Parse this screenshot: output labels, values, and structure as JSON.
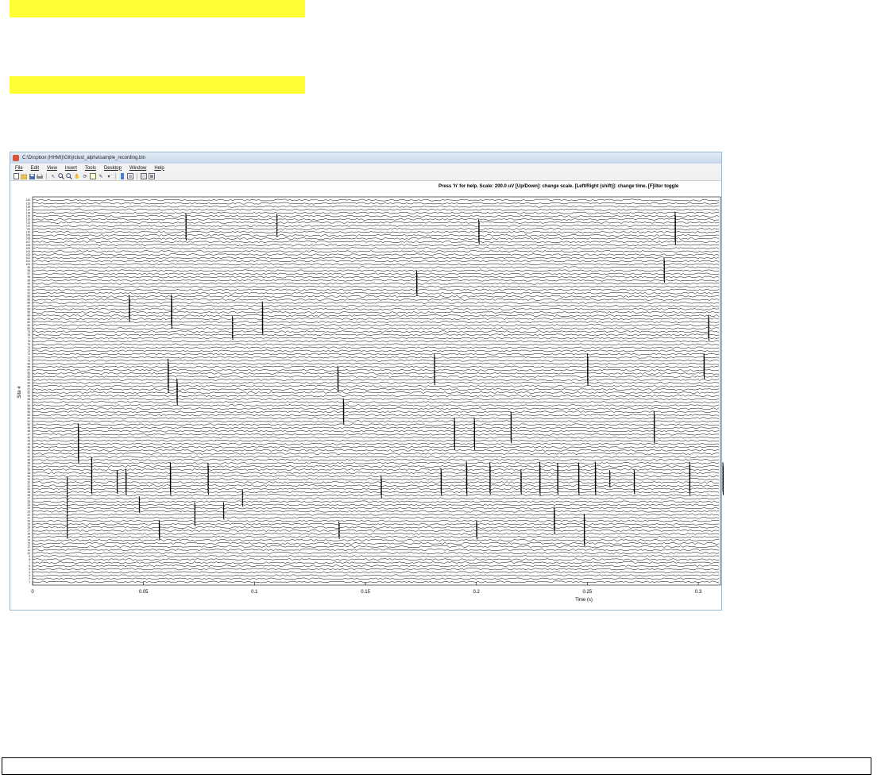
{
  "window": {
    "title": "C:\\Dropbox (HHMI)\\Git\\jrclust_alpha\\sample_recording.bin",
    "menu": [
      {
        "id": "file",
        "label": "File"
      },
      {
        "id": "edit",
        "label": "Edit"
      },
      {
        "id": "view",
        "label": "View"
      },
      {
        "id": "insert",
        "label": "Insert"
      },
      {
        "id": "tools",
        "label": "Tools"
      },
      {
        "id": "desktop",
        "label": "Desktop"
      },
      {
        "id": "window",
        "label": "Window"
      },
      {
        "id": "help",
        "label": "Help"
      }
    ],
    "toolbar_icons": [
      "new-file-icon",
      "open-file-icon",
      "save-icon",
      "print-icon",
      "pointer-icon",
      "zoom-in-icon",
      "zoom-out-icon",
      "pan-icon",
      "rotate-icon",
      "data-cursor-icon",
      "brush-icon",
      "link-icon",
      "colorbar-icon",
      "legend-icon",
      "grid-icon",
      "plot-tools-icon"
    ]
  },
  "plot": {
    "help_text": "Press 'h' for help. Scale: 200.0 uV [Up/Down]: change scale. [Left/Right (shift)]: change time. [F]ilter toggle",
    "chart_data": {
      "type": "line",
      "title": "",
      "xlabel": "Time (s)",
      "ylabel": "Site #",
      "xlim": [
        0,
        0.31
      ],
      "x_ticks": [
        0,
        0.05,
        0.1,
        0.15,
        0.2,
        0.25,
        0.3
      ],
      "x_tick_labels": [
        "0",
        "0.05",
        "0.1",
        "0.15",
        "0.2",
        "0.25",
        "0.3"
      ],
      "num_channels": 120,
      "scale_uV": 200.0,
      "trace_color": "#000000",
      "spike_events": [
        {
          "t": 0.0155,
          "ch_from": 14,
          "ch_to": 32,
          "amp": 1.0
        },
        {
          "t": 0.0205,
          "ch_from": 38,
          "ch_to": 48,
          "amp": 2.0
        },
        {
          "t": 0.0265,
          "ch_from": 28,
          "ch_to": 38,
          "amp": 1.4
        },
        {
          "t": 0.038,
          "ch_from": 28,
          "ch_to": 34,
          "amp": 1.2
        },
        {
          "t": 0.042,
          "ch_from": 28,
          "ch_to": 34,
          "amp": 1.8
        },
        {
          "t": 0.0435,
          "ch_from": 82,
          "ch_to": 88,
          "amp": 2.0
        },
        {
          "t": 0.048,
          "ch_from": 22,
          "ch_to": 26,
          "amp": 1.0
        },
        {
          "t": 0.057,
          "ch_from": 14,
          "ch_to": 18,
          "amp": 1.8
        },
        {
          "t": 0.061,
          "ch_from": 60,
          "ch_to": 68,
          "amp": 2.2
        },
        {
          "t": 0.062,
          "ch_from": 28,
          "ch_to": 36,
          "amp": 2.0
        },
        {
          "t": 0.0625,
          "ch_from": 80,
          "ch_to": 88,
          "amp": 2.2
        },
        {
          "t": 0.065,
          "ch_from": 56,
          "ch_to": 62,
          "amp": 2.0
        },
        {
          "t": 0.069,
          "ch_from": 107,
          "ch_to": 114,
          "amp": 1.2
        },
        {
          "t": 0.073,
          "ch_from": 18,
          "ch_to": 24,
          "amp": 1.2
        },
        {
          "t": 0.079,
          "ch_from": 28,
          "ch_to": 36,
          "amp": 1.6
        },
        {
          "t": 0.086,
          "ch_from": 20,
          "ch_to": 24,
          "amp": 1.2
        },
        {
          "t": 0.09,
          "ch_from": 76,
          "ch_to": 82,
          "amp": 1.2
        },
        {
          "t": 0.0945,
          "ch_from": 24,
          "ch_to": 28,
          "amp": 1.0
        },
        {
          "t": 0.1035,
          "ch_from": 78,
          "ch_to": 86,
          "amp": 2.0
        },
        {
          "t": 0.11,
          "ch_from": 108,
          "ch_to": 114,
          "amp": 1.0
        },
        {
          "t": 0.1375,
          "ch_from": 60,
          "ch_to": 66,
          "amp": 1.8
        },
        {
          "t": 0.138,
          "ch_from": 14,
          "ch_to": 18,
          "amp": 1.2
        },
        {
          "t": 0.14,
          "ch_from": 50,
          "ch_to": 56,
          "amp": 1.8
        },
        {
          "t": 0.157,
          "ch_from": 27,
          "ch_to": 32,
          "amp": 1.6
        },
        {
          "t": 0.173,
          "ch_from": 90,
          "ch_to": 96,
          "amp": 1.6
        },
        {
          "t": 0.181,
          "ch_from": 62,
          "ch_to": 70,
          "amp": 1.4
        },
        {
          "t": 0.184,
          "ch_from": 28,
          "ch_to": 34,
          "amp": 2.0
        },
        {
          "t": 0.19,
          "ch_from": 42,
          "ch_to": 50,
          "amp": 1.8
        },
        {
          "t": 0.1955,
          "ch_from": 28,
          "ch_to": 36,
          "amp": 2.2
        },
        {
          "t": 0.199,
          "ch_from": 42,
          "ch_to": 50,
          "amp": 1.8
        },
        {
          "t": 0.2,
          "ch_from": 14,
          "ch_to": 18,
          "amp": 1.6
        },
        {
          "t": 0.201,
          "ch_from": 106,
          "ch_to": 112,
          "amp": 1.4
        },
        {
          "t": 0.206,
          "ch_from": 28,
          "ch_to": 36,
          "amp": 1.6
        },
        {
          "t": 0.2155,
          "ch_from": 44,
          "ch_to": 52,
          "amp": 1.6
        },
        {
          "t": 0.22,
          "ch_from": 28,
          "ch_to": 34,
          "amp": 1.4
        },
        {
          "t": 0.2285,
          "ch_from": 28,
          "ch_to": 36,
          "amp": 2.0
        },
        {
          "t": 0.235,
          "ch_from": 16,
          "ch_to": 22,
          "amp": 2.0
        },
        {
          "t": 0.2365,
          "ch_from": 28,
          "ch_to": 36,
          "amp": 1.6
        },
        {
          "t": 0.246,
          "ch_from": 28,
          "ch_to": 36,
          "amp": 1.8
        },
        {
          "t": 0.2485,
          "ch_from": 12,
          "ch_to": 20,
          "amp": 1.8
        },
        {
          "t": 0.25,
          "ch_from": 62,
          "ch_to": 70,
          "amp": 1.8
        },
        {
          "t": 0.2535,
          "ch_from": 28,
          "ch_to": 36,
          "amp": 2.0
        },
        {
          "t": 0.26,
          "ch_from": 30,
          "ch_to": 34,
          "amp": 1.2
        },
        {
          "t": 0.271,
          "ch_from": 28,
          "ch_to": 34,
          "amp": 1.4
        },
        {
          "t": 0.28,
          "ch_from": 44,
          "ch_to": 52,
          "amp": 1.8
        },
        {
          "t": 0.2845,
          "ch_from": 94,
          "ch_to": 100,
          "amp": 1.4
        },
        {
          "t": 0.2895,
          "ch_from": 106,
          "ch_to": 114,
          "amp": 2.0
        },
        {
          "t": 0.296,
          "ch_from": 28,
          "ch_to": 36,
          "amp": 2.0
        },
        {
          "t": 0.3025,
          "ch_from": 64,
          "ch_to": 70,
          "amp": 1.8
        },
        {
          "t": 0.3045,
          "ch_from": 76,
          "ch_to": 82,
          "amp": 1.6
        },
        {
          "t": 0.311,
          "ch_from": 28,
          "ch_to": 36,
          "amp": 1.8
        }
      ]
    }
  }
}
